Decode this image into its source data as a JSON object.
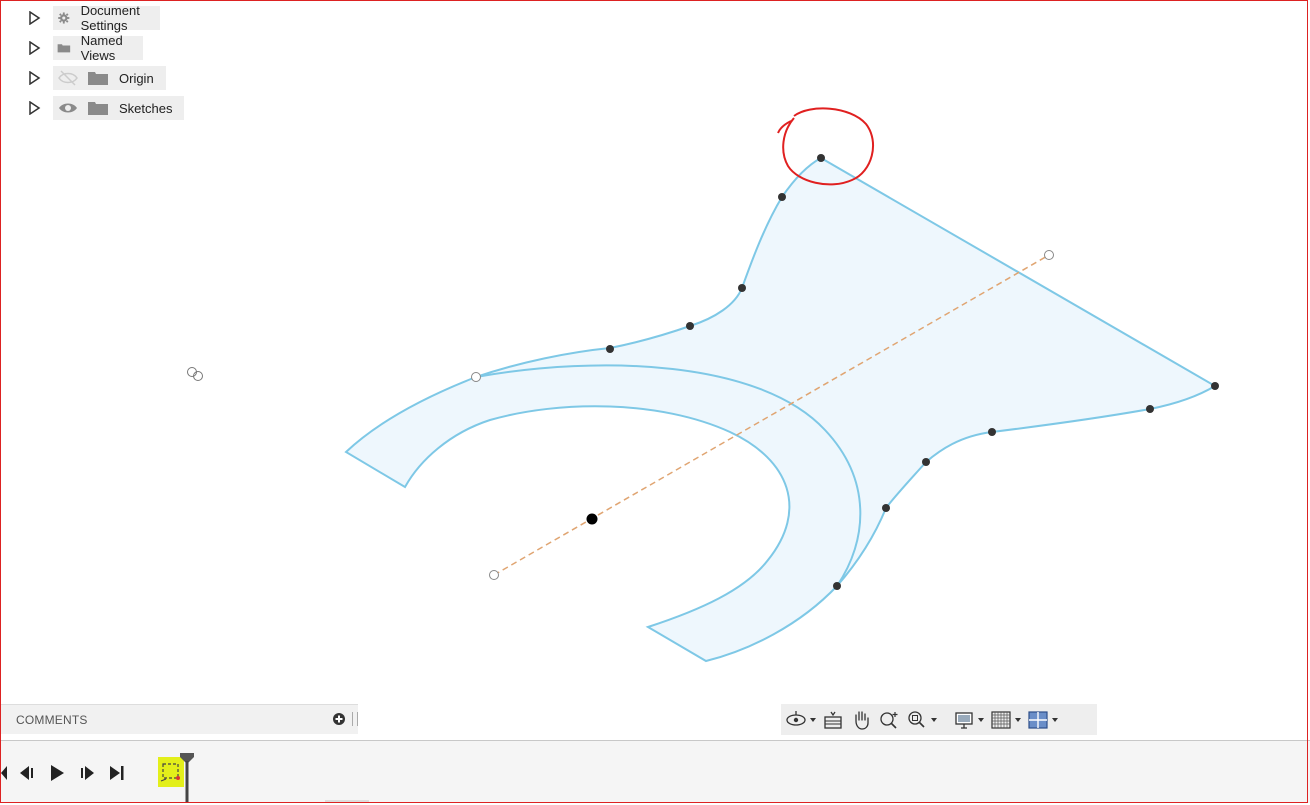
{
  "browser": {
    "items": [
      {
        "label": "Document Settings",
        "icon": "gear-icon",
        "visibility": "none"
      },
      {
        "label": "Named Views",
        "icon": "folder-icon",
        "visibility": "none"
      },
      {
        "label": "Origin",
        "icon": "folder-icon",
        "visibility": "hidden-eye-icon"
      },
      {
        "label": "Sketches",
        "icon": "folder-icon",
        "visibility": "eye-icon"
      }
    ]
  },
  "comments": {
    "label": "COMMENTS"
  },
  "navbar": {
    "tools": [
      "orbit-icon",
      "look-at-icon",
      "pan-icon",
      "zoom-icon",
      "fit-icon",
      "display-settings-icon",
      "grid-icon",
      "viewports-icon"
    ]
  },
  "timeline": {
    "controls": [
      "rewind-icon",
      "step-back-icon",
      "play-icon",
      "step-forward-icon",
      "go-to-end-icon"
    ],
    "feature": "sketch-feature-icon"
  },
  "colors": {
    "sketch_fill": "#eef7fd",
    "sketch_stroke": "#7ec8e6",
    "construction_line": "#e0a572",
    "annotation": "#e02020",
    "feature_highlight": "#e3ef1a"
  }
}
